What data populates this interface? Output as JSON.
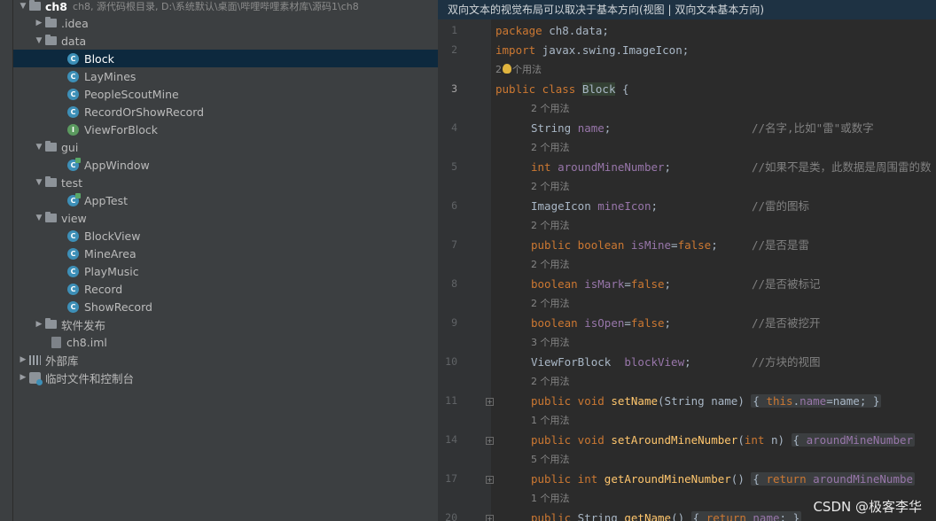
{
  "project": {
    "name": "ch8",
    "path": "ch8, 源代码根目录, D:\\系统默认\\桌面\\哔哩哔哩素材库\\源码1\\ch8",
    "items": [
      {
        "label": ".idea",
        "kind": "folder",
        "expanded": false
      },
      {
        "label": "data",
        "kind": "folder",
        "expanded": true
      },
      {
        "label": "Block",
        "kind": "class"
      },
      {
        "label": "LayMines",
        "kind": "class"
      },
      {
        "label": "PeopleScoutMine",
        "kind": "class"
      },
      {
        "label": "RecordOrShowRecord",
        "kind": "class"
      },
      {
        "label": "ViewForBlock",
        "kind": "interface"
      },
      {
        "label": "gui",
        "kind": "folder",
        "expanded": true
      },
      {
        "label": "AppWindow",
        "kind": "class-runnable"
      },
      {
        "label": "test",
        "kind": "folder",
        "expanded": true
      },
      {
        "label": "AppTest",
        "kind": "class-runnable"
      },
      {
        "label": "view",
        "kind": "folder",
        "expanded": true
      },
      {
        "label": "BlockView",
        "kind": "class"
      },
      {
        "label": "MineArea",
        "kind": "class"
      },
      {
        "label": "PlayMusic",
        "kind": "class"
      },
      {
        "label": "Record",
        "kind": "class"
      },
      {
        "label": "ShowRecord",
        "kind": "class"
      },
      {
        "label": "软件发布",
        "kind": "folder",
        "expanded": false
      },
      {
        "label": "ch8.iml",
        "kind": "file"
      },
      {
        "label": "外部库",
        "kind": "library",
        "expanded": false
      },
      {
        "label": "临时文件和控制台",
        "kind": "scratch",
        "expanded": false
      }
    ],
    "selected": "Block"
  },
  "editor": {
    "banner": "双向文本的视觉布局可以取决于基本方向(视图 | 双向文本基本方向)",
    "line_numbers": [
      "1",
      "2",
      "3",
      "4",
      "5",
      "6",
      "7",
      "8",
      "9",
      "10",
      "11",
      "14",
      "17",
      "20"
    ],
    "current_line": "3",
    "usage_hints": {
      "class": "2个用法",
      "name": "2 个用法",
      "aroundMineNumber": "2 个用法",
      "mineIcon": "2 个用法",
      "isMine": "2 个用法",
      "isMark": "2 个用法",
      "isOpen": "2 个用法",
      "blockView": "3 个用法",
      "setName": "2 个用法",
      "setAroundMineNumber": "1 个用法",
      "getAroundMineNumber": "5 个用法",
      "getName": "1 个用法"
    },
    "code": {
      "l1_kw": "package",
      "l1_rest": " ch8.data;",
      "l2_kw": "import",
      "l2_rest": " javax.swing.ImageIcon;",
      "l3_kw": "public class",
      "l3_name": "Block",
      "l3_rest": " {",
      "l4_type": "String",
      "l4_field": "name",
      "l4_comment": "//名字,比如\"雷\"或数字",
      "l5_type": "int",
      "l5_field": "aroundMineNumber",
      "l5_comment": "//如果不是类，此数据是周围雷的数",
      "l6_type": "ImageIcon",
      "l6_field": "mineIcon",
      "l6_comment": "//雷的图标",
      "l7_kw": "public boolean",
      "l7_field": "isMine",
      "l7_val": "false",
      "l7_comment": "//是否是雷",
      "l8_kw": "boolean",
      "l8_field": "isMark",
      "l8_val": "false",
      "l8_comment": "//是否被标记",
      "l9_kw": "boolean",
      "l9_field": "isOpen",
      "l9_val": "false",
      "l9_comment": "//是否被挖开",
      "l10_type": "ViewForBlock",
      "l10_field": "blockView",
      "l10_comment": "//方块的视图",
      "l11_kw": "public void",
      "l11_method": "setName",
      "l11_params": "(String name)",
      "l11_this": "this",
      "l11_field": "name",
      "l11_body_end": "=name;",
      "l14_kw": "public void",
      "l14_method": "setAroundMineNumber",
      "l14_params_a": "(",
      "l14_int": "int",
      "l14_params_b": " n)",
      "l14_field": "aroundMineNumber",
      "l17_kw": "public int",
      "l17_method": "getAroundMineNumber",
      "l17_params": "()",
      "l17_return": "return",
      "l17_field": "aroundMineNumbe",
      "l20_kw": "public",
      "l20_type": " String ",
      "l20_method": "getName",
      "l20_params": "()",
      "l20_return": "return",
      "l20_field": "name",
      "l20_end": ";"
    }
  },
  "watermark": "CSDN @极客李华"
}
